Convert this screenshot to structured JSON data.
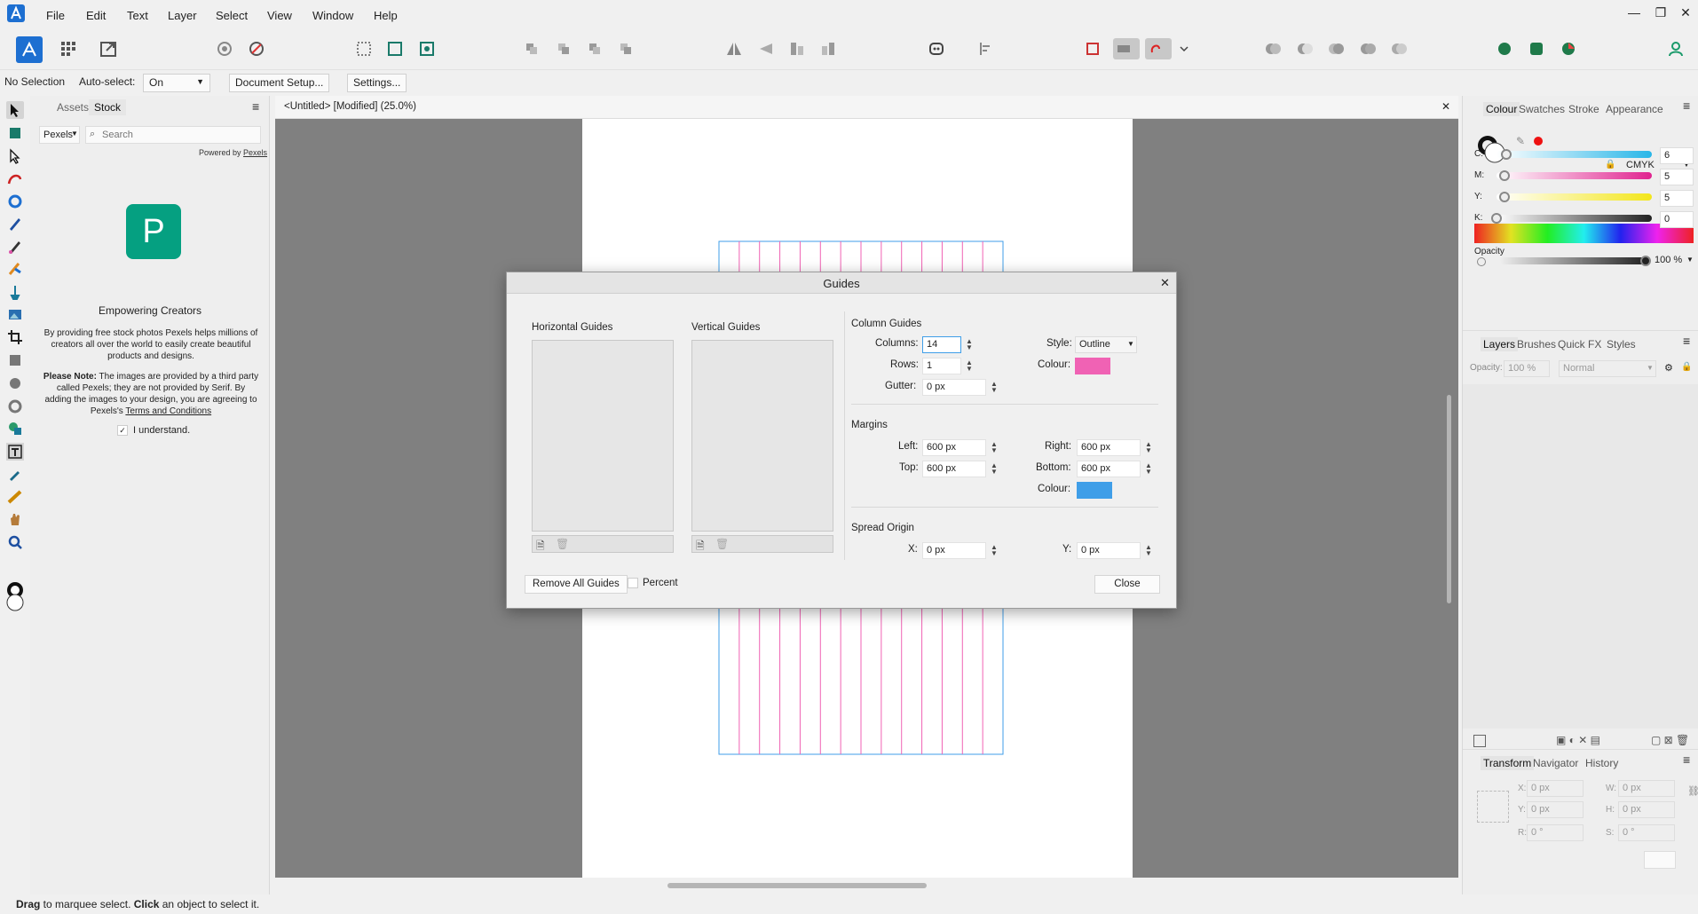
{
  "menubar": {
    "items": [
      "File",
      "Edit",
      "Text",
      "Layer",
      "Select",
      "View",
      "Window",
      "Help"
    ]
  },
  "window_controls": {
    "minimize": "—",
    "maximize": "❐",
    "close": "✕"
  },
  "context_bar": {
    "selection": "No Selection",
    "auto_select_label": "Auto-select:",
    "auto_select_value": "On",
    "document_setup": "Document Setup...",
    "settings": "Settings..."
  },
  "left_panel": {
    "tabs": [
      "Assets",
      "Stock"
    ],
    "source": "Pexels",
    "search_placeholder": "Search",
    "powered_by": "Powered by",
    "powered_link": "Pexels",
    "logo_letter": "P",
    "heading": "Empowering Creators",
    "blurb": "By providing free stock photos Pexels helps millions of creators all over the world to easily create beautiful products and designs.",
    "note_bold": "Please Note:",
    "note_text": " The images are provided by a third party called Pexels; they are not provided by Serif. By adding the images to your design, you are agreeing to Pexels's ",
    "note_link": "Terms and Conditions",
    "checkbox_label": "I understand."
  },
  "document": {
    "title": "<Untitled> [Modified] (25.0%)",
    "close": "✕"
  },
  "dialog": {
    "title": "Guides",
    "close": "✕",
    "horizontal_guides": "Horizontal Guides",
    "vertical_guides": "Vertical Guides",
    "column_guides": "Column Guides",
    "columns_label": "Columns:",
    "columns_value": "14",
    "rows_label": "Rows:",
    "rows_value": "1",
    "gutter_label": "Gutter:",
    "gutter_value": "0 px",
    "style_label": "Style:",
    "style_value": "Outline",
    "colour_label": "Colour:",
    "column_colour": "#f062b4",
    "margins": "Margins",
    "left_label": "Left:",
    "left_value": "600 px",
    "top_label": "Top:",
    "top_value": "600 px",
    "right_label": "Right:",
    "right_value": "600 px",
    "bottom_label": "Bottom:",
    "bottom_value": "600 px",
    "margin_colour": "#3f9ee8",
    "spread_origin": "Spread Origin",
    "x_label": "X:",
    "x_value": "0 px",
    "y_label": "Y:",
    "y_value": "0 px",
    "remove_all": "Remove All Guides",
    "percent": "Percent",
    "close_button": "Close"
  },
  "colour_panel": {
    "tabs": [
      "Colour",
      "Swatches",
      "Stroke",
      "Appearance"
    ],
    "model": "CMYK",
    "channels": [
      {
        "label": "C:",
        "value": "6",
        "color": "#28b6e8"
      },
      {
        "label": "M:",
        "value": "5",
        "color": "#e0238f"
      },
      {
        "label": "Y:",
        "value": "5",
        "color": "#f3e61a"
      },
      {
        "label": "K:",
        "value": "0",
        "color": "#222222"
      }
    ],
    "opacity_label": "Opacity",
    "opacity_value": "100 %"
  },
  "layers_panel": {
    "tabs": [
      "Layers",
      "Brushes",
      "Quick FX",
      "Styles"
    ],
    "opacity_label": "Opacity:",
    "opacity_value": "100 %",
    "blend_mode": "Normal"
  },
  "transform_panel": {
    "tabs": [
      "Transform",
      "Navigator",
      "History"
    ],
    "x_label": "X:",
    "x_value": "0 px",
    "y_label": "Y:",
    "y_value": "0 px",
    "w_label": "W:",
    "w_value": "0 px",
    "h_label": "H:",
    "h_value": "0 px",
    "r_label": "R:",
    "r_value": "0 °",
    "s_label": "S:",
    "s_value": "0 °"
  },
  "status": {
    "bold1": "Drag",
    "text1": " to marquee select. ",
    "bold2": "Click",
    "text2": " an object to select it."
  },
  "accent_color": "#3f9ee8"
}
